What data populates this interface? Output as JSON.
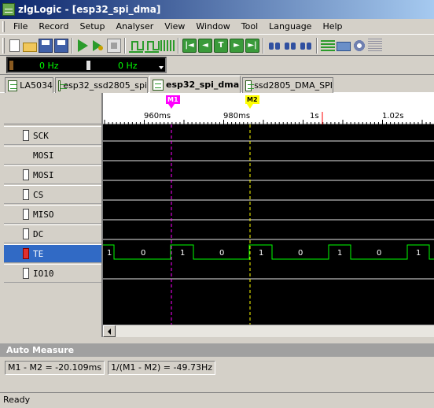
{
  "window": {
    "title": "zlgLogic - [esp32_spi_dma]"
  },
  "menu": [
    "File",
    "Record",
    "Setup",
    "Analyser",
    "View",
    "Window",
    "Tool",
    "Language",
    "Help"
  ],
  "toolbar": {
    "icons": [
      "new-doc-icon",
      "open-folder-icon",
      "save-icon",
      "save-all-icon",
      "run-icon",
      "run-step-icon",
      "stop-icon",
      "wave-trigger-icon",
      "wave-trigger-2-icon",
      "bar-signal-icon",
      "nav-first-icon",
      "nav-prev-icon",
      "nav-home-icon",
      "nav-next-icon",
      "nav-last-icon",
      "find-icon",
      "find-next-icon",
      "find-prev-icon",
      "channel-list-icon",
      "capture-icon",
      "settings-icon",
      "lines-icon"
    ]
  },
  "sample": {
    "rate1": "0 Hz",
    "rate2": "0 Hz"
  },
  "tabs": [
    "LA5034",
    "esp32_ssd2805_spi",
    "esp32_spi_dma",
    "ssd2805_DMA_SPI"
  ],
  "active_tab": 2,
  "channels": [
    {
      "label": "SCK",
      "has_icon": true,
      "selected": false
    },
    {
      "label": "MOSI",
      "has_icon": false,
      "selected": false
    },
    {
      "label": "MOSI",
      "has_icon": true,
      "selected": false
    },
    {
      "label": "CS",
      "has_icon": true,
      "selected": false
    },
    {
      "label": "MISO",
      "has_icon": true,
      "selected": false
    },
    {
      "label": "DC",
      "has_icon": true,
      "selected": false
    },
    {
      "label": "TE",
      "has_icon": true,
      "selected": true
    },
    {
      "label": "IO10",
      "has_icon": true,
      "selected": false
    }
  ],
  "ruler": {
    "labels": [
      "960ms",
      "980ms",
      "1s",
      "1.02s"
    ],
    "cursors": [
      "M1",
      "M2"
    ]
  },
  "te_signal": {
    "bits": [
      "1",
      "0",
      "1",
      "0",
      "1",
      "0",
      "1",
      "0",
      "1"
    ]
  },
  "colors": {
    "m1": "#ff00ff",
    "m2": "#ffff00",
    "signal": "#00ff00",
    "trigger": "#ff0000"
  },
  "measure": {
    "header": "Auto Measure",
    "values": [
      "M1 - M2 = -20.109ms",
      "1/(M1 - M2) = -49.73Hz"
    ]
  },
  "status": "Ready"
}
